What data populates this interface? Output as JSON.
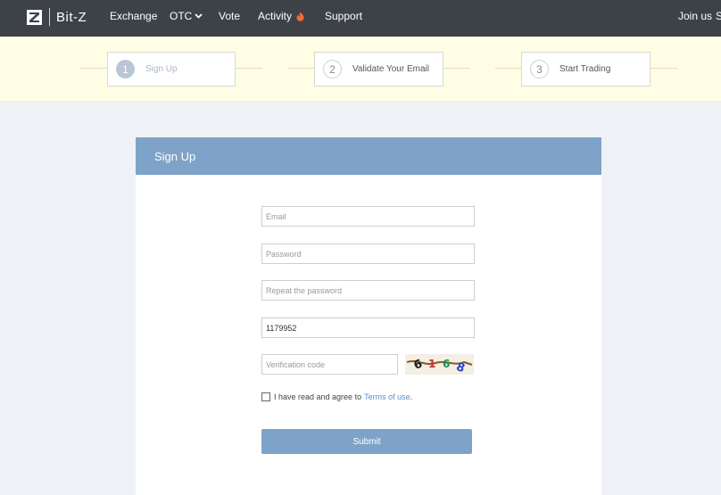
{
  "brand": {
    "name": "Bit-Z",
    "icon": "bitz-logo-icon"
  },
  "nav": {
    "exchange": "Exchange",
    "otc": "OTC",
    "vote": "Vote",
    "activity": "Activity",
    "support": "Support",
    "join": "Join us",
    "more": "S"
  },
  "steps": [
    {
      "num": "1",
      "label": "Sign Up"
    },
    {
      "num": "2",
      "label": "Validate Your Email"
    },
    {
      "num": "3",
      "label": "Start Trading"
    }
  ],
  "form": {
    "title": "Sign Up",
    "email_placeholder": "Email",
    "password_placeholder": "Password",
    "repeat_placeholder": "Repeat the password",
    "referral_value": "1179952",
    "code_placeholder": "Verification code",
    "captcha_text": "6168",
    "agree_text": "I have read and agree to",
    "terms_link": "Terms of use",
    "agree_end": ".",
    "submit_label": "Submit"
  },
  "colors": {
    "nav_bg": "#3d4248",
    "steps_bg": "#fffde4",
    "accent": "#7fa3c8",
    "link": "#5a8fc6",
    "page_bg": "#eef2f6"
  }
}
